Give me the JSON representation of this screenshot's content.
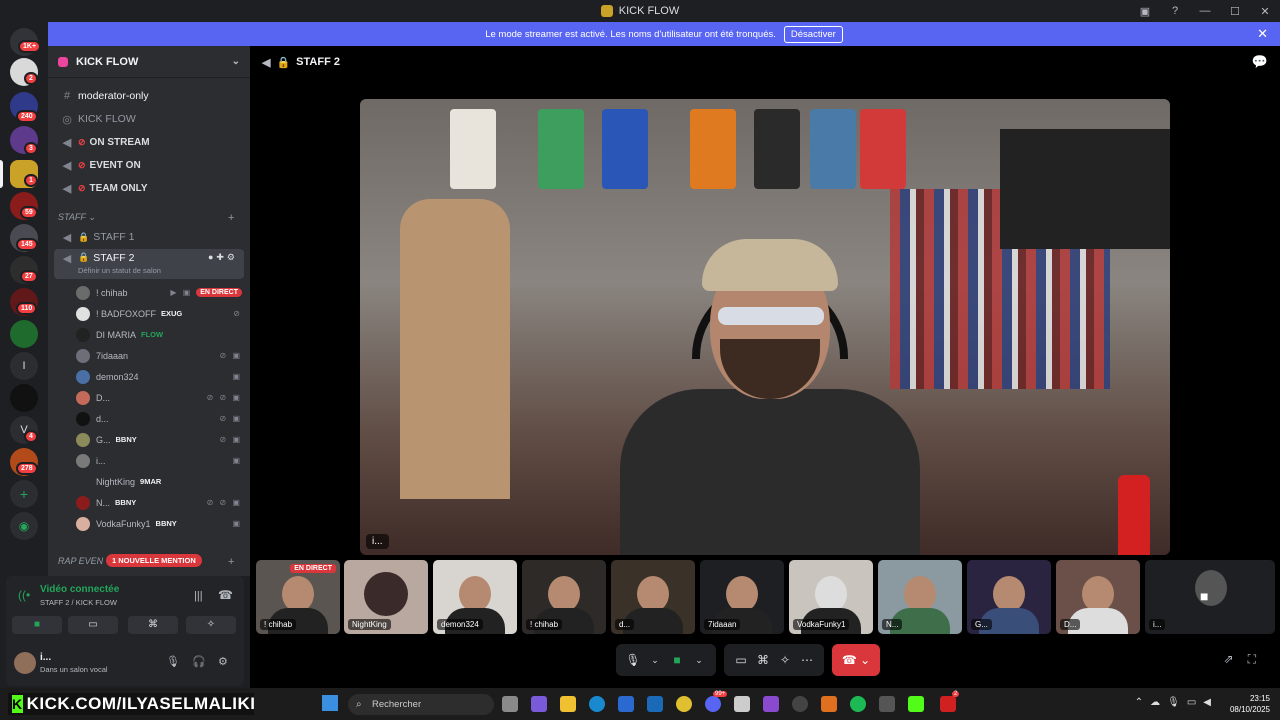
{
  "window": {
    "title": "KICK FLOW",
    "controls": [
      "—",
      "☐",
      "✕"
    ]
  },
  "banner": {
    "text": "Le mode streamer est activé. Les noms d'utilisateur ont été tronqués.",
    "button": "Désactiver"
  },
  "rail": {
    "badges": [
      "1K+",
      "2",
      "240",
      "3",
      "1",
      "59",
      "145",
      "27",
      "110",
      "4",
      "278"
    ],
    "letters": [
      "I",
      "V"
    ]
  },
  "server": {
    "name": "KICK FLOW"
  },
  "channels": [
    {
      "name": "moderator-only",
      "type": "text"
    },
    {
      "name": "KICK FLOW",
      "type": "forum"
    },
    {
      "name": "ON STREAM",
      "type": "voice-locked"
    },
    {
      "name": "EVENT ON",
      "type": "voice-locked"
    },
    {
      "name": "TEAM ONLY",
      "type": "voice-locked"
    }
  ],
  "category_staff": "STAFF",
  "staff_channels": [
    {
      "name": "STAFF 1"
    },
    {
      "name": "STAFF 2",
      "subtitle": "Définir un statut de salon"
    }
  ],
  "members": [
    {
      "name": "! chihab",
      "tag": "",
      "live": "EN DIRECT"
    },
    {
      "name": "! BADFOXOFF",
      "tag": "EXUG"
    },
    {
      "name": "DI MARIA",
      "tag": "FLOW"
    },
    {
      "name": "7idaaan",
      "tag": ""
    },
    {
      "name": "demon324",
      "tag": ""
    },
    {
      "name": "D...",
      "tag": ""
    },
    {
      "name": "d...",
      "tag": ""
    },
    {
      "name": "G...",
      "tag": "BBNY"
    },
    {
      "name": "i...",
      "tag": ""
    },
    {
      "name": "NightKing",
      "tag": "9MAR"
    },
    {
      "name": "N...",
      "tag": "BBNY"
    },
    {
      "name": "VodkaFunky1",
      "tag": "BBNY"
    }
  ],
  "category_rap": "RAP EVEN",
  "mention": "1 NOUVELLE MENTION",
  "voice": {
    "status": "Vidéo connectée",
    "channel": "STAFF 2 / KICK FLOW"
  },
  "user": {
    "name": "i...",
    "status": "Dans un salon vocal"
  },
  "main": {
    "channel": "STAFF 2",
    "stage_name": "i..."
  },
  "thumbnails": [
    {
      "label": "! chihab",
      "live": "EN DIRECT"
    },
    {
      "label": "NightKing"
    },
    {
      "label": "demon324"
    },
    {
      "label": "! chihab"
    },
    {
      "label": "d..."
    },
    {
      "label": "7idaaan"
    },
    {
      "label": "VodkaFunky1"
    },
    {
      "label": "N..."
    },
    {
      "label": "G..."
    },
    {
      "label": "D..."
    },
    {
      "label": "i..."
    }
  ],
  "taskbar": {
    "kick": "KICK.COM/ILYASELMALIKI",
    "search": "Rechercher",
    "time": "23:15",
    "date": "08/10/2025",
    "discord_badge": "99+",
    "app_badge": "2"
  }
}
